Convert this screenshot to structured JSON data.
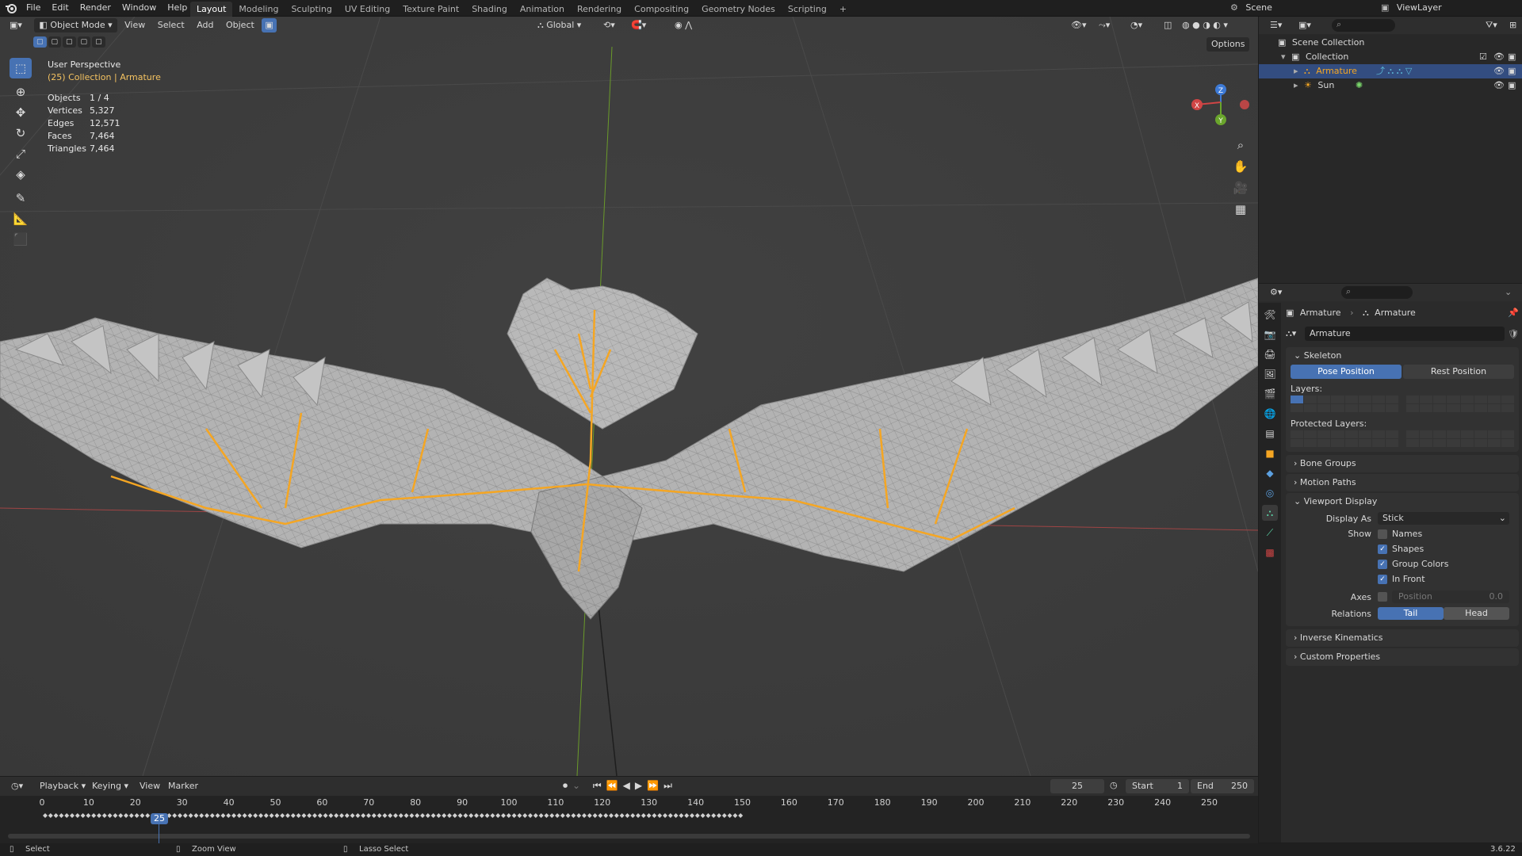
{
  "topbar": {
    "menus": [
      "File",
      "Edit",
      "Render",
      "Window",
      "Help"
    ],
    "workspaces": [
      "Layout",
      "Modeling",
      "Sculpting",
      "UV Editing",
      "Texture Paint",
      "Shading",
      "Animation",
      "Rendering",
      "Compositing",
      "Geometry Nodes",
      "Scripting"
    ],
    "active_workspace": "Layout",
    "add_tab": "+",
    "scene": "Scene",
    "view_layer": "ViewLayer"
  },
  "viewport_header": {
    "mode": "Object Mode",
    "menus": [
      "View",
      "Select",
      "Add",
      "Object"
    ],
    "orientation": "Global",
    "options": "Options"
  },
  "viewport": {
    "perspective": "User Perspective",
    "collection_prefix": "(25) Collection | ",
    "collection_object": "Armature",
    "stats": [
      {
        "label": "Objects",
        "value": "1 / 4"
      },
      {
        "label": "Vertices",
        "value": "5,327"
      },
      {
        "label": "Edges",
        "value": "12,571"
      },
      {
        "label": "Faces",
        "value": "7,464"
      },
      {
        "label": "Triangles",
        "value": "7,464"
      }
    ],
    "gizmo": {
      "x": "X",
      "y": "Y",
      "z": "Z"
    }
  },
  "outliner": {
    "root": "Scene Collection",
    "collection": "Collection",
    "items": [
      {
        "name": "Armature",
        "selected": true
      },
      {
        "name": "Sun",
        "selected": false
      }
    ]
  },
  "properties": {
    "breadcrumb": [
      "Armature",
      "Armature"
    ],
    "data_name": "Armature",
    "skeleton": {
      "title": "Skeleton",
      "pose_position": "Pose Position",
      "rest_position": "Rest Position",
      "layers_label": "Layers:",
      "protected_layers_label": "Protected Layers:"
    },
    "collapsed_panels": [
      "Bone Groups",
      "Motion Paths"
    ],
    "viewport_display": {
      "title": "Viewport Display",
      "display_as_label": "Display As",
      "display_as_value": "Stick",
      "show_label": "Show",
      "show_options": [
        {
          "label": "Names",
          "checked": false
        },
        {
          "label": "Shapes",
          "checked": true
        },
        {
          "label": "Group Colors",
          "checked": true
        },
        {
          "label": "In Front",
          "checked": true
        }
      ],
      "axes_label": "Axes",
      "axes_position_label": "Position",
      "axes_position_value": "0.0",
      "relations_label": "Relations",
      "relations_tail": "Tail",
      "relations_head": "Head"
    },
    "bottom_panels": [
      "Inverse Kinematics",
      "Custom Properties"
    ]
  },
  "timeline": {
    "menus": [
      "Playback",
      "Keying",
      "View",
      "Marker"
    ],
    "current_frame": "25",
    "start_label": "Start",
    "start_value": "1",
    "end_label": "End",
    "end_value": "250",
    "ticks": [
      "0",
      "10",
      "20",
      "25",
      "30",
      "40",
      "50",
      "60",
      "70",
      "80",
      "90",
      "100",
      "110",
      "120",
      "130",
      "140",
      "150",
      "160",
      "170",
      "180",
      "190",
      "200",
      "210",
      "220",
      "230",
      "240",
      "250"
    ]
  },
  "statusbar": {
    "select": "Select",
    "zoom_view": "Zoom View",
    "lasso_select": "Lasso Select",
    "version": "3.6.22"
  },
  "colors": {
    "accent": "#4772b3",
    "selection_orange": "#f5a623",
    "header_bg": "#1f1f1f",
    "viewport_bg": "#3d3d3d"
  }
}
